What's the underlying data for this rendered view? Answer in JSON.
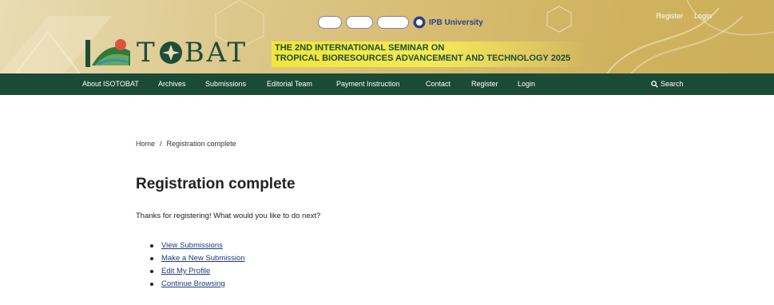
{
  "header": {
    "logo_text": "ISOTOBAT",
    "seminar_line1": "THE 2ND INTERNATIONAL SEMINAR ON",
    "seminar_line2": "TROPICAL BIORESOURCES ADVANCEMENT AND TECHNOLOGY 2025",
    "partner_name": "IPB University",
    "top_links": {
      "register": "Register",
      "login": "Login"
    }
  },
  "nav": {
    "items": [
      {
        "label": "About ISOTOBAT"
      },
      {
        "label": "Archives"
      },
      {
        "label": "Submissions"
      },
      {
        "label": "Editorial Team"
      },
      {
        "label": "Payment Instruction"
      },
      {
        "label": "Contact"
      },
      {
        "label": "Register"
      },
      {
        "label": "Login"
      }
    ],
    "search_label": "Search",
    "search_icon": "search-icon"
  },
  "breadcrumb": {
    "home": "Home",
    "separator": "/",
    "current": "Registration complete"
  },
  "main": {
    "title": "Registration complete",
    "intro": "Thanks for registering! What would you like to do next?",
    "actions": [
      {
        "label": "View Submissions"
      },
      {
        "label": "Make a New Submission"
      },
      {
        "label": "Edit My Profile"
      },
      {
        "label": "Continue Browsing"
      }
    ]
  },
  "colors": {
    "nav_bg": "#1b4b37",
    "banner_gold": "#d7bd72",
    "link": "#1e3c78",
    "title_green": "#1d4d39"
  }
}
